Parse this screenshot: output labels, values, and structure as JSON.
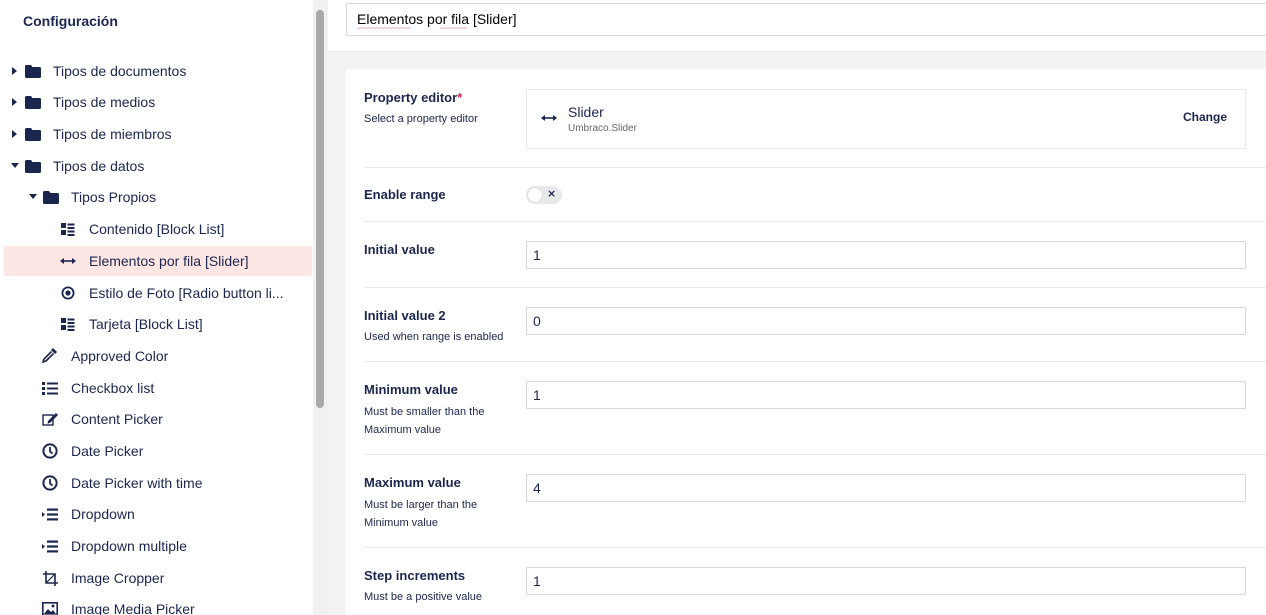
{
  "sidebar": {
    "title": "Configuración",
    "items": [
      {
        "label": "Tipos de documentos",
        "icon": "folder-icon"
      },
      {
        "label": "Tipos de medios",
        "icon": "folder-icon"
      },
      {
        "label": "Tipos de miembros",
        "icon": "folder-icon"
      },
      {
        "label": "Tipos de datos",
        "icon": "folder-icon"
      },
      {
        "label": "Tipos Propios",
        "icon": "folder-icon"
      },
      {
        "label": "Contenido [Block List]",
        "icon": "block-list-icon"
      },
      {
        "label": "Elementos por fila [Slider]",
        "icon": "slider-icon"
      },
      {
        "label": "Estilo de Foto [Radio button li...",
        "icon": "radio-button-icon"
      },
      {
        "label": "Tarjeta [Block List]",
        "icon": "block-list-icon"
      },
      {
        "label": "Approved Color",
        "icon": "color-picker-icon"
      },
      {
        "label": "Checkbox list",
        "icon": "checkbox-list-icon"
      },
      {
        "label": "Content Picker",
        "icon": "content-picker-icon"
      },
      {
        "label": "Date Picker",
        "icon": "clock-icon"
      },
      {
        "label": "Date Picker with time",
        "icon": "clock-icon"
      },
      {
        "label": "Dropdown",
        "icon": "dropdown-icon"
      },
      {
        "label": "Dropdown multiple",
        "icon": "dropdown-icon"
      },
      {
        "label": "Image Cropper",
        "icon": "crop-icon"
      },
      {
        "label": "Image Media Picker",
        "icon": "image-icon"
      }
    ]
  },
  "header": {
    "name_value": "Elementos por fila [Slider]"
  },
  "property_editor": {
    "label": "Property editor",
    "required_mark": "*",
    "description": "Select a property editor",
    "editor_name": "Slider",
    "editor_alias": "Umbraco.Slider",
    "change_label": "Change"
  },
  "enable_range": {
    "label": "Enable range",
    "toggle_symbol": "×"
  },
  "initial_value": {
    "label": "Initial value",
    "value": "1"
  },
  "initial_value_2": {
    "label": "Initial value 2",
    "description": "Used when range is enabled",
    "value": "0"
  },
  "minimum_value": {
    "label": "Minimum value",
    "description": "Must be smaller than the Maximum value",
    "value": "1"
  },
  "maximum_value": {
    "label": "Maximum value",
    "description": "Must be larger than the Minimum value",
    "value": "4"
  },
  "step_increments": {
    "label": "Step increments",
    "description": "Must be a positive value",
    "value": "1"
  },
  "colors": {
    "active_row": "#fde6e4",
    "text": "#1b264f",
    "required": "#d42054"
  }
}
